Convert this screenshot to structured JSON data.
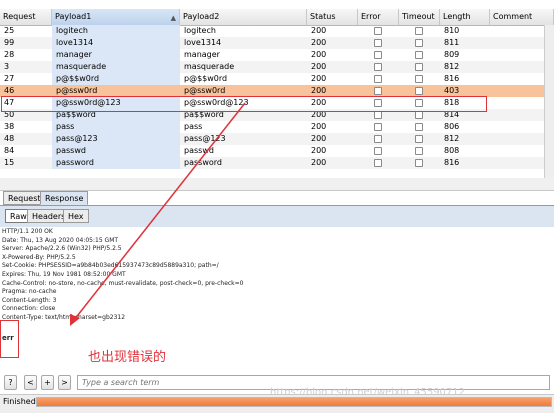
{
  "columns": [
    "Request",
    "Payload1",
    "Payload2",
    "Status",
    "Error",
    "Timeout",
    "Length",
    "Comment"
  ],
  "rows": [
    {
      "request": "25",
      "payload1": "logitech",
      "payload2": "logitech",
      "status": "200",
      "length": "810"
    },
    {
      "request": "99",
      "payload1": "love1314",
      "payload2": "love1314",
      "status": "200",
      "length": "811"
    },
    {
      "request": "28",
      "payload1": "manager",
      "payload2": "manager",
      "status": "200",
      "length": "809"
    },
    {
      "request": "3",
      "payload1": "masquerade",
      "payload2": "masquerade",
      "status": "200",
      "length": "812"
    },
    {
      "request": "27",
      "payload1": "p@$$w0rd",
      "payload2": "p@$$w0rd",
      "status": "200",
      "length": "816"
    },
    {
      "request": "46",
      "payload1": "p@ssw0rd",
      "payload2": "p@ssw0rd",
      "status": "200",
      "length": "403",
      "highlighted": true
    },
    {
      "request": "47",
      "payload1": "p@ssw0rd@123",
      "payload2": "p@ssw0rd@123",
      "status": "200",
      "length": "818"
    },
    {
      "request": "50",
      "payload1": "pa$$word",
      "payload2": "pa$$word",
      "status": "200",
      "length": "814"
    },
    {
      "request": "38",
      "payload1": "pass",
      "payload2": "pass",
      "status": "200",
      "length": "806"
    },
    {
      "request": "48",
      "payload1": "pass@123",
      "payload2": "pass@123",
      "status": "200",
      "length": "812"
    },
    {
      "request": "84",
      "payload1": "passwd",
      "payload2": "passwd",
      "status": "200",
      "length": "808"
    },
    {
      "request": "15",
      "payload1": "password",
      "payload2": "password",
      "status": "200",
      "length": "816"
    }
  ],
  "tabs": {
    "request": "Request",
    "response": "Response"
  },
  "subtabs": {
    "raw": "Raw",
    "headers": "Headers",
    "hex": "Hex"
  },
  "response_lines": [
    "HTTP/1.1 200 OK",
    "Date: Thu, 13 Aug 2020 04:05:15 GMT",
    "Server: Apache/2.2.6 (Win32) PHP/5.2.5",
    "X-Powered-By: PHP/5.2.5",
    "Set-Cookie: PHPSESSID=a9b84b03ed615937473c89d5889a310; path=/",
    "Expires: Thu, 19 Nov 1981 08:52:00 GMT",
    "Cache-Control: no-store, no-cache, must-revalidate, post-check=0, pre-check=0",
    "Pragma: no-cache",
    "Content-Length: 3",
    "Connection: close",
    "Content-Type: text/html;charset=gb2312"
  ],
  "response_body": "err",
  "annotation": "也出现错误的",
  "buttons": {
    "help": "?",
    "prev": "<",
    "add": "+",
    "next": ">"
  },
  "search": {
    "placeholder": "Type a search term"
  },
  "status": {
    "text": "Finished",
    "progress_percent": 100
  },
  "watermark": "https://blog.csdn.net/weixin_45590712",
  "colors": {
    "highlight_row": "#f8c39b",
    "annotation_red": "#e0323a",
    "progress": "#f07a3c"
  }
}
